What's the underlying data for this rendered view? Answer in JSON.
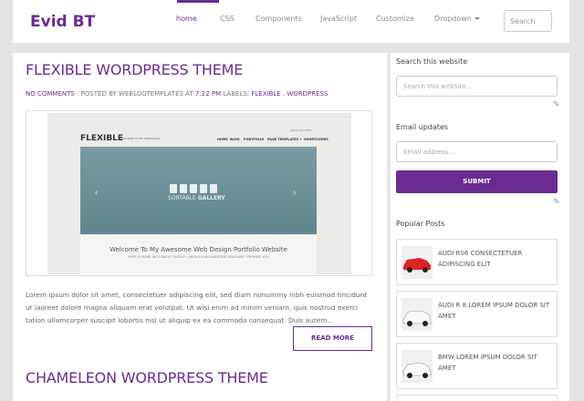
{
  "brand": "Evid BT",
  "nav": {
    "items": [
      "home",
      "CSS",
      "Components",
      "JavaScript",
      "Customize",
      "Dropdown"
    ],
    "active": "home",
    "search_placeholder": "Search"
  },
  "posts": [
    {
      "title": "FLEXIBLE WORDPRESS THEME",
      "meta": {
        "comments": "NO COMMENTS",
        "posted_by_prefix": " : POSTED BY ",
        "author": "WEBLOGTEMPLATES",
        "at": " AT ",
        "time": "7:22 PM",
        "labels_prefix": " LABELS: ",
        "labels": "FLEXIBLE . WORDPRESS"
      },
      "image": {
        "logo": "FLEXIBLE",
        "tagline": "WELCOME TO MY PORTFOLIO",
        "contact": "(800) 555-5555",
        "nav": [
          "HOME",
          "BLOG",
          "PORTFOLIO",
          "PAGE TEMPLATES ▾",
          "SHORTCODES"
        ],
        "gallery_left": "SORTABLE",
        "gallery_right": "GALLERY",
        "welcome": "Welcome To My Awesome Web Design Portfolio Website",
        "welcome_sub": "HERE IS MORE INFO ABOUT MYSELF I AM SUCH AN AWESOME DESIGNER I PROMISE YOU"
      },
      "excerpt": "Lorem ipsum dolor sit amet, consectetuer adipiscing elit, sed diam nonummy nibh euismod tincidunt ut laoreet dolore magna aliquam erat volutpat. Ut wisi enim ad minim veniam, quis nostrud exerci tation ullamcorper suscipit lobortis nisl ut aliquip ex ea commodo consequat. Duis autem...",
      "read_more": "READ MORE"
    },
    {
      "title": "CHAMELEON WORDPRESS THEME"
    }
  ],
  "sidebar": {
    "search": {
      "title": "Search this website",
      "placeholder": "Search this website..."
    },
    "email": {
      "title": "Email updates",
      "placeholder": "Email address...",
      "submit": "SUBMIT"
    },
    "popular": {
      "title": "Popular Posts",
      "items": [
        {
          "title": "AUDI RS6 CONSECTETUER ADIPISCING ELIT",
          "thumb_color": "#d22"
        },
        {
          "title": "AUDI R 8 LOREM IPSUM DOLOR SIT AMET",
          "thumb_color": "#eee"
        },
        {
          "title": "BMW LOREM IPSUM DOLOR SIT AMET",
          "thumb_color": "#eee"
        }
      ]
    }
  },
  "colors": {
    "accent": "#6a2c91",
    "background": "#e4e4e4"
  }
}
